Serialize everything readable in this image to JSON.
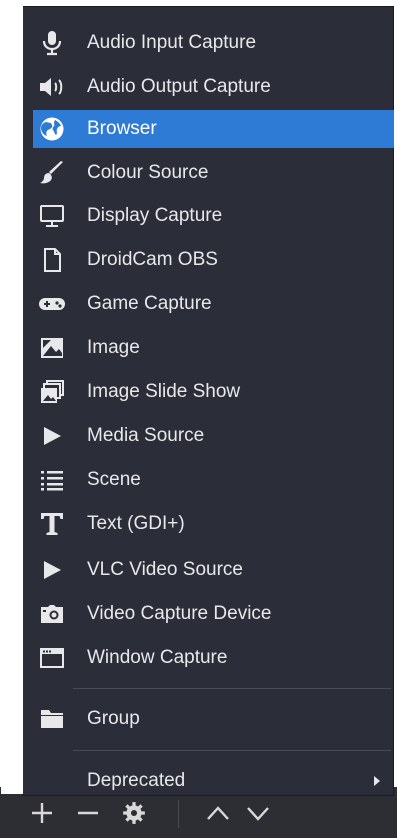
{
  "menu": {
    "items": [
      {
        "label": "Audio Input Capture",
        "icon": "microphone-icon"
      },
      {
        "label": "Audio Output Capture",
        "icon": "speaker-icon"
      },
      {
        "label": "Browser",
        "icon": "globe-icon",
        "selected": true
      },
      {
        "label": "Colour Source",
        "icon": "paint-brush-icon"
      },
      {
        "label": "Display Capture",
        "icon": "monitor-icon"
      },
      {
        "label": "DroidCam OBS",
        "icon": "file-icon"
      },
      {
        "label": "Game Capture",
        "icon": "gamepad-icon"
      },
      {
        "label": "Image",
        "icon": "image-icon"
      },
      {
        "label": "Image Slide Show",
        "icon": "slideshow-icon"
      },
      {
        "label": "Media Source",
        "icon": "play-icon"
      },
      {
        "label": "Scene",
        "icon": "list-icon"
      },
      {
        "label": "Text (GDI+)",
        "icon": "text-icon"
      },
      {
        "label": "VLC Video Source",
        "icon": "play-icon"
      },
      {
        "label": "Video Capture Device",
        "icon": "camera-icon"
      },
      {
        "label": "Window Capture",
        "icon": "window-icon"
      }
    ],
    "group_label": "Group",
    "group_icon": "folder-icon",
    "deprecated_label": "Deprecated"
  },
  "toolbar": {
    "icons": [
      "add-icon",
      "remove-icon",
      "gear-icon",
      "move-up-icon",
      "move-down-icon"
    ]
  },
  "colors": {
    "menu_bg": "#2b2e38",
    "selected_bg": "#2e7bd6",
    "text": "#e8e8ea",
    "toolbar_bg": "#2d2e33"
  }
}
